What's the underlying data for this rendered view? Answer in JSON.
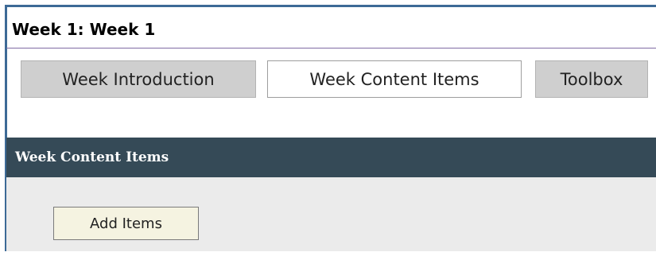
{
  "page": {
    "title": "Week 1: Week 1"
  },
  "tabs": [
    {
      "label": "Week Introduction",
      "active": false
    },
    {
      "label": "Week Content Items",
      "active": true
    },
    {
      "label": "Toolbox",
      "active": false
    }
  ],
  "section": {
    "header": "Week Content Items",
    "add_button_label": "Add Items"
  },
  "colors": {
    "frame_border": "#3d6a96",
    "section_header_bg": "#354a57",
    "tab_inactive_bg": "#cfcfcf",
    "button_bg": "#f5f3e1"
  }
}
